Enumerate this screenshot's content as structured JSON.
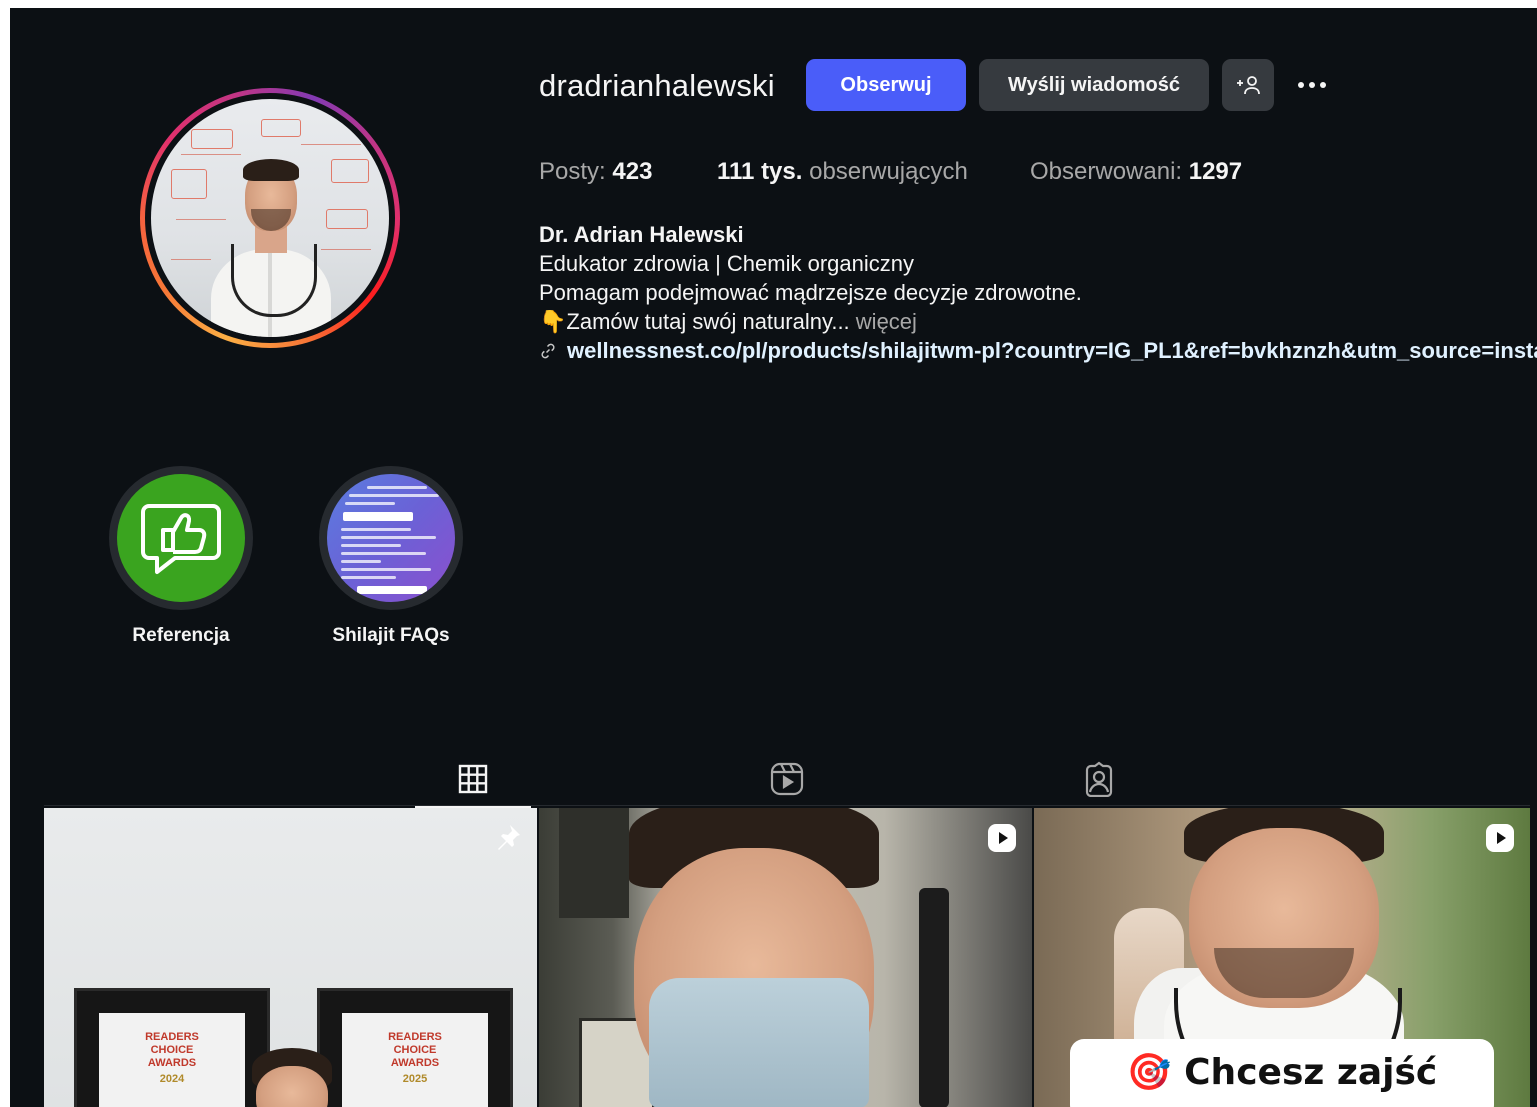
{
  "profile": {
    "username": "dradrianhalewski",
    "follow_label": "Obserwuj",
    "message_label": "Wyślij wiadomość",
    "suggest_label": "+",
    "more_icon": "more-horizontal-icon"
  },
  "stats": {
    "posts_label": "Posty:",
    "posts_value": "423",
    "followers_value": "111 tys.",
    "followers_label": "obserwujących",
    "following_label": "Obserwowani:",
    "following_value": "1297"
  },
  "bio": {
    "name": "Dr. Adrian Halewski",
    "line1": "Edukator zdrowia | Chemik organiczny",
    "line2": "Pomagam podejmować mądrzejsze decyzje zdrowotne.",
    "line3_emoji": "👇",
    "line3_text": "Zamów tutaj swój naturalny...",
    "more": "więcej",
    "link_icon": "link-icon",
    "link": "wellnessnest.co/pl/products/shilajitwm-pl?country=IG_PL1&ref=bvkhznzh&utm_source=insta..."
  },
  "highlights": [
    {
      "label": "Referencja",
      "icon": "thumbs-up-chat-icon"
    },
    {
      "label": "Shilajit FAQs",
      "icon": "faq-cover"
    }
  ],
  "tabs": [
    {
      "name": "posts",
      "icon": "grid-icon",
      "active": true
    },
    {
      "name": "reels",
      "icon": "reels-icon",
      "active": false
    },
    {
      "name": "tagged",
      "icon": "tagged-icon",
      "active": false
    }
  ],
  "posts": [
    {
      "badge": "pin-icon",
      "award_text_1": "READERS",
      "award_text_2": "CHOICE",
      "award_text_3": "AWARDS",
      "award_year_1": "2024",
      "award_year_2": "2025"
    },
    {
      "badge": "reel-icon"
    },
    {
      "badge": "reel-icon",
      "caption_emoji": "🎯",
      "caption": "Chcesz zajść"
    }
  ],
  "colors": {
    "background": "#0c1014",
    "follow_button": "#4a5df9",
    "secondary_button": "#363a3f",
    "muted_text": "#a8a8a8",
    "link": "#e0f1ff",
    "highlight_green": "#3aa41f"
  }
}
